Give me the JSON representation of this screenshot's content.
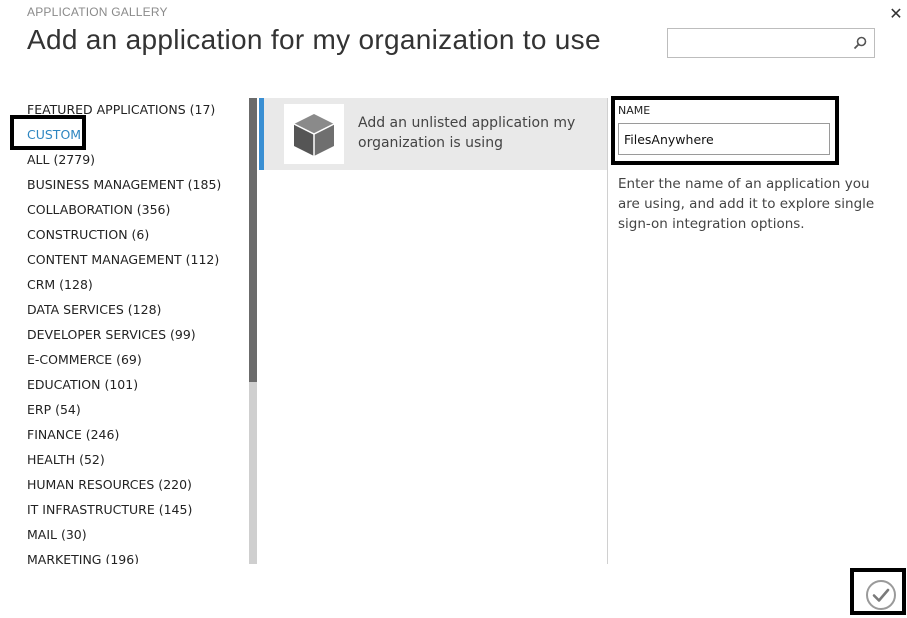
{
  "header": {
    "supertitle": "APPLICATION GALLERY",
    "title": "Add an application for my organization to use",
    "close_icon": "close-icon",
    "search": {
      "value": "",
      "placeholder": "",
      "icon": "search-icon"
    }
  },
  "categories": [
    {
      "label": "FEATURED APPLICATIONS (17)",
      "selected": false
    },
    {
      "label": "CUSTOM",
      "selected": true
    },
    {
      "label": "ALL (2779)",
      "selected": false
    },
    {
      "label": "BUSINESS MANAGEMENT (185)",
      "selected": false
    },
    {
      "label": "COLLABORATION (356)",
      "selected": false
    },
    {
      "label": "CONSTRUCTION (6)",
      "selected": false
    },
    {
      "label": "CONTENT MANAGEMENT (112)",
      "selected": false
    },
    {
      "label": "CRM (128)",
      "selected": false
    },
    {
      "label": "DATA SERVICES (128)",
      "selected": false
    },
    {
      "label": "DEVELOPER SERVICES (99)",
      "selected": false
    },
    {
      "label": "E-COMMERCE (69)",
      "selected": false
    },
    {
      "label": "EDUCATION (101)",
      "selected": false
    },
    {
      "label": "ERP (54)",
      "selected": false
    },
    {
      "label": "FINANCE (246)",
      "selected": false
    },
    {
      "label": "HEALTH (52)",
      "selected": false
    },
    {
      "label": "HUMAN RESOURCES (220)",
      "selected": false
    },
    {
      "label": "IT INFRASTRUCTURE (145)",
      "selected": false
    },
    {
      "label": "MAIL (30)",
      "selected": false
    },
    {
      "label": "MARKETING (196)",
      "selected": false
    }
  ],
  "apps": [
    {
      "label": "Add an unlisted application my organization is using",
      "icon": "package-box-icon"
    }
  ],
  "details": {
    "name_label": "NAME",
    "name_value": "FilesAnywhere",
    "help_text": "Enter the name of an application you are using, and add it to explore single sign-on integration options."
  },
  "footer": {
    "confirm_icon": "checkmark-icon"
  },
  "colors": {
    "accent": "#3a8fd3",
    "selected_text": "#2e86c1",
    "tile_background": "#e9e9e9",
    "scroll_thumb": "#6b6b6b"
  }
}
